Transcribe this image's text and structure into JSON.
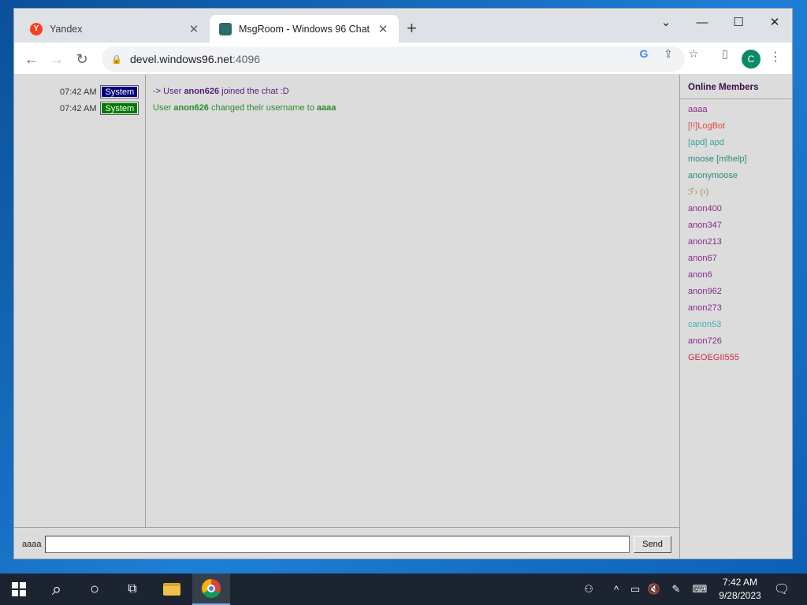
{
  "browser": {
    "tabs": [
      {
        "label": "Yandex",
        "icon": "yandex-icon",
        "active": false
      },
      {
        "label": "MsgRoom - Windows 96 Chat",
        "icon": "msgroom-icon",
        "active": true
      }
    ],
    "url": {
      "host": "devel.windows96.net",
      "port": ":4096"
    },
    "profile_initial": "C",
    "favicon_letter": "Y"
  },
  "chat": {
    "messages": [
      {
        "time": "07:42 AM",
        "badge": "System",
        "badge_color": "#000080",
        "prefix": "-> User ",
        "user": "anon626",
        "suffix": " joined the chat :D",
        "color": "#5a1a7a"
      },
      {
        "time": "07:42 AM",
        "badge": "System",
        "badge_color": "#007a00",
        "prefix": "User ",
        "user": "anon626",
        "suffix": " changed their username to ",
        "extra": "aaaa",
        "color": "#2d8a2d"
      }
    ],
    "members_title": "Online Members",
    "members": [
      {
        "name": "aaaa",
        "color": "#8a2b8a"
      },
      {
        "name": "[!!]LogBot",
        "color": "#e04848"
      },
      {
        "name": "[apd] apd",
        "color": "#38a0a0"
      },
      {
        "name": "moose [mlhelp]",
        "color": "#2e8a7a"
      },
      {
        "name": "anonymoose",
        "color": "#2e8a7a"
      },
      {
        "name": "ℱ› (›)",
        "color": "#a08a50"
      },
      {
        "name": "anon400",
        "color": "#8a2b8a"
      },
      {
        "name": "anon347",
        "color": "#8a2b8a"
      },
      {
        "name": "anon213",
        "color": "#8a2b8a"
      },
      {
        "name": "anon67",
        "color": "#8a2b8a"
      },
      {
        "name": "anon6",
        "color": "#8a2b8a"
      },
      {
        "name": "anon962",
        "color": "#8a2b8a"
      },
      {
        "name": "anon273",
        "color": "#8a2b8a"
      },
      {
        "name": "canon53",
        "color": "#40b0b0"
      },
      {
        "name": "anon726",
        "color": "#8a2b8a"
      },
      {
        "name": "GEOEGII555",
        "color": "#d0284a"
      }
    ],
    "composer": {
      "nick": "aaaa",
      "input_value": "",
      "send_label": "Send"
    }
  },
  "taskbar": {
    "clock_time": "7:42 AM",
    "clock_date": "9/28/2023"
  }
}
